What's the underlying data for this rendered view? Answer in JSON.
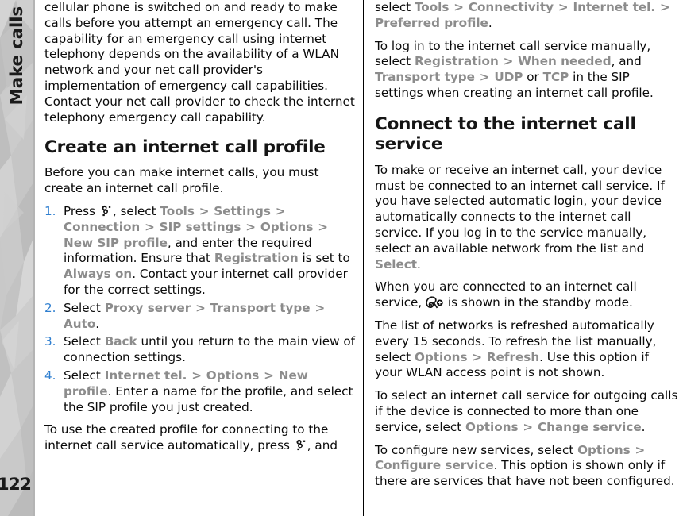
{
  "sidebar": {
    "chapter_label": "Make calls",
    "page_number": "122"
  },
  "icons": {
    "menu_key": "menu-key-icon",
    "internet_call": "internet-call-indicator-icon"
  },
  "colors": {
    "ui_reference": "#8c8c8c",
    "list_number": "#2f7fd0",
    "body_text": "#0a0a0a",
    "sidebar_bg": "#c9c9c9"
  },
  "left_column": {
    "para_continued": {
      "text": "cellular phone is switched on and ready to make calls before you attempt an emergency call. The capability for an emergency call using internet telephony depends on the availability of a WLAN network and your net call provider's implementation of emergency call capabilities. Contact your net call provider to check the internet telephony emergency call capability."
    },
    "heading": "Create an internet call profile",
    "intro": "Before you can make internet calls, you must create an internet call profile.",
    "steps": [
      {
        "num": "1.",
        "t1": "Press ",
        "icon": "menu-key-icon",
        "t2": ", select ",
        "ui1": "Tools",
        "sep1": ">",
        "ui2": "Settings",
        "sep2": ">",
        "ui3": "Connection",
        "sep3": ">",
        "ui4": "SIP settings",
        "sep4": ">",
        "ui5": "Options",
        "sep5": ">",
        "ui6": "New SIP profile",
        "t3": ", and enter the required information. Ensure that ",
        "ui7": "Registration",
        "t4": " is set to ",
        "ui8": "Always on",
        "t5": ". Contact your internet call provider for the correct settings."
      },
      {
        "num": "2.",
        "t1": "Select ",
        "ui1": "Proxy server",
        "sep1": ">",
        "ui2": "Transport type",
        "sep2": ">",
        "ui3": "Auto",
        "t2": "."
      },
      {
        "num": "3.",
        "t1": "Select ",
        "ui1": "Back",
        "t2": " until you return to the main view of connection settings."
      },
      {
        "num": "4.",
        "t1": "Select ",
        "ui1": "Internet tel.",
        "sep1": ">",
        "ui2": "Options",
        "sep2": ">",
        "ui3": "New profile",
        "t2": ". Enter a name for the profile, and select the SIP profile you just created."
      }
    ],
    "closing": {
      "t1": "To use the created profile for connecting to the internet call service automatically, press ",
      "icon": "menu-key-icon",
      "t2": ", and"
    }
  },
  "right_column": {
    "para_continued": {
      "t1": "select ",
      "ui1": "Tools",
      "sep1": ">",
      "ui2": "Connectivity",
      "sep2": ">",
      "ui3": "Internet tel.",
      "sep3": ">",
      "ui4": "Preferred profile",
      "t2": "."
    },
    "para_login": {
      "t1": "To log in to the internet call service manually, select ",
      "ui1": "Registration",
      "sep1": ">",
      "ui2": "When needed",
      "t2": ", and ",
      "ui3": "Transport type",
      "sep2": ">",
      "ui4": "UDP",
      "t3": " or ",
      "ui5": "TCP",
      "t4": " in the SIP settings when creating an internet call profile."
    },
    "heading": "Connect to the internet call service",
    "para_make": {
      "t1": "To make or receive an internet call, your device must be connected to an internet call service. If you have selected automatic login, your device automatically connects to the internet call service. If you log in to the service manually, select an available network from the list and ",
      "ui1": "Select",
      "t2": "."
    },
    "para_connected": {
      "t1": "When you are connected to an internet call service, ",
      "icon": "internet-call-indicator-icon",
      "t2": " is shown in the standby mode."
    },
    "para_refresh": {
      "t1": "The list of networks is refreshed automatically every 15 seconds. To refresh the list manually, select ",
      "ui1": "Options",
      "sep1": ">",
      "ui2": "Refresh",
      "t2": ". Use this option if your WLAN access point is not shown."
    },
    "para_outgoing": {
      "t1": "To select an internet call service for outgoing calls if the device is connected to more than one service, select ",
      "ui1": "Options",
      "sep1": ">",
      "ui2": "Change service",
      "t2": "."
    },
    "para_configure": {
      "t1": "To configure new services, select ",
      "ui1": "Options",
      "sep1": ">",
      "ui2": "Configure service",
      "t2": ". This option is shown only if there are services that have not been configured."
    }
  }
}
